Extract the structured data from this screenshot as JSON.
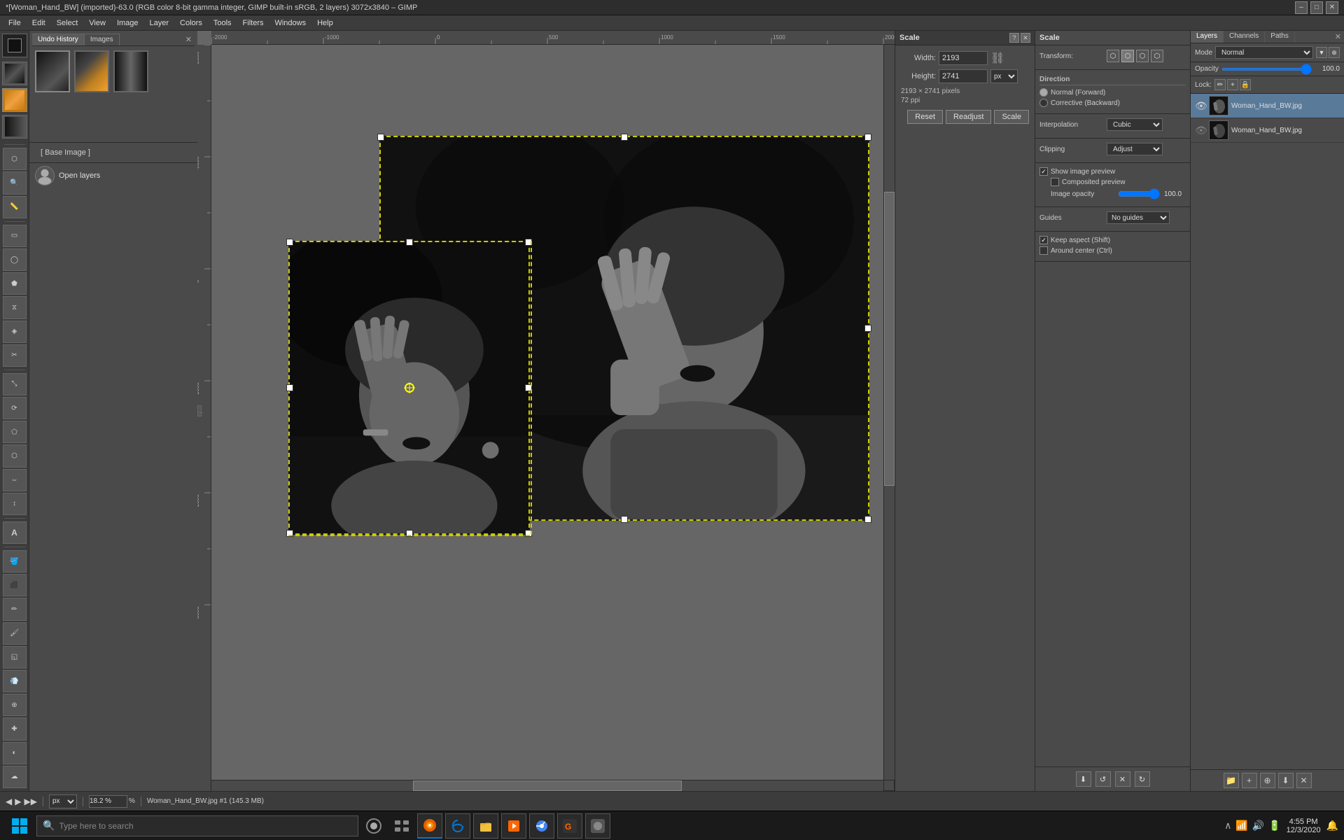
{
  "titlebar": {
    "title": "*[Woman_Hand_BW] (imported)-63.0 (RGB color 8-bit gamma integer, GIMP built-in sRGB, 2 layers) 3072x3840 – GIMP",
    "minimize": "–",
    "maximize": "□",
    "close": "✕"
  },
  "menubar": {
    "items": [
      "File",
      "Edit",
      "Select",
      "View",
      "Image",
      "Layer",
      "Colors",
      "Tools",
      "Filters",
      "Windows",
      "Help"
    ]
  },
  "toolbox": {
    "tools": [
      "⬡",
      "↖",
      "✂",
      "⬚",
      "⟳",
      "↕",
      "✒",
      "✏",
      "🖌",
      "◈",
      "⚓",
      "◐",
      "A",
      "/"
    ]
  },
  "left_panel": {
    "tabs": [
      "Undo History",
      "Images"
    ],
    "active_tab": "Images",
    "base_image_label": "[ Base Image ]",
    "open_layers_label": "Open layers"
  },
  "scale_dialog": {
    "title": "Scale",
    "width_label": "Width:",
    "width_value": "2193",
    "height_label": "Height:",
    "height_value": "2741",
    "unit": "px",
    "pixel_info": "2193 × 2741 pixels",
    "ppi_info": "72 ppi",
    "buttons": {
      "reset": "Reset",
      "readjust": "Readjust",
      "scale": "Scale"
    }
  },
  "transform_options": {
    "title": "Scale",
    "transform_label": "Transform:",
    "direction_label": "Direction",
    "normal_label": "Normal (Forward)",
    "corrective_label": "Corrective (Backward)",
    "interpolation_label": "Interpolation",
    "interpolation_value": "Cubic",
    "clipping_label": "Clipping",
    "clipping_value": "Adjust",
    "show_preview_label": "Show image preview",
    "composited_preview_label": "Composited preview",
    "image_opacity_label": "Image opacity",
    "image_opacity_value": "100.0",
    "guides_label": "Guides",
    "guides_value": "No guides",
    "keep_aspect_label": "Keep aspect (Shift)",
    "around_center_label": "Around center (Ctrl)"
  },
  "layers_panel": {
    "tabs": [
      "Layers",
      "Channels",
      "Paths"
    ],
    "active_tab": "Layers",
    "mode_label": "Mode",
    "mode_value": "Normal",
    "opacity_label": "Opacity",
    "opacity_value": "100.0",
    "lock_label": "Lock:",
    "layers": [
      {
        "name": "Woman_Hand_BW.jpg",
        "visible": true,
        "selected": true
      },
      {
        "name": "Woman_Hand_BW.jpg",
        "visible": false,
        "selected": false
      }
    ],
    "bottom_icons": [
      "+",
      "✱",
      "⬇",
      "✕",
      "⬆"
    ]
  },
  "statusbar": {
    "zoom_unit": "px",
    "zoom_value": "18.2 %",
    "filename": "Woman_Hand_BW.jpg #1 (145.3 MB)"
  },
  "taskbar": {
    "search_placeholder": "Type here to search",
    "time": "4:55 PM",
    "date": "12/3/2020",
    "start_icon": "⊞",
    "app_icons": [
      "🔍",
      "🗂",
      "🌐",
      "📁",
      "🎵",
      "🌐",
      "🎮",
      "G"
    ]
  }
}
